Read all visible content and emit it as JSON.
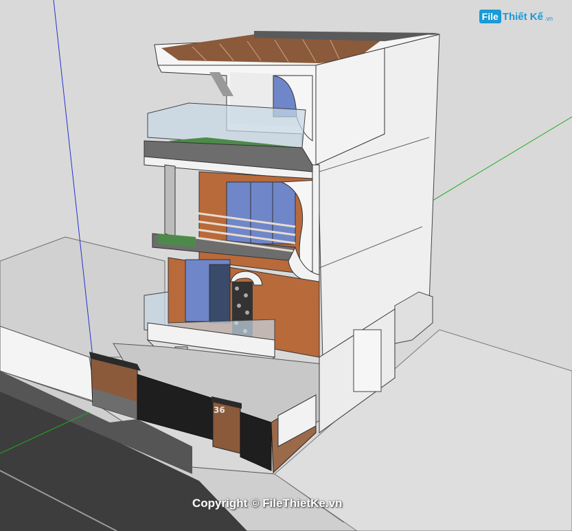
{
  "watermark": {
    "logo_badge": "File",
    "logo_word": "Thiết Kế",
    "logo_domain": ".vn",
    "copyright": "Copyright © FileThietKe.vn"
  },
  "model": {
    "house_number": "36"
  },
  "colors": {
    "ground": "#d9d9d9",
    "wall_white": "#f2f2f2",
    "wall_shadow": "#e3e3e3",
    "brick": "#b86a3a",
    "glass": "#b9cfe3",
    "window_blue": "#6f86c9",
    "road": "#3a3a3a",
    "gate": "#1e1e1e",
    "roof_wood": "#8a5a3b",
    "axis_blue": "#2233cc",
    "axis_green": "#22aa22",
    "logo_blue": "#1a9ad6"
  }
}
